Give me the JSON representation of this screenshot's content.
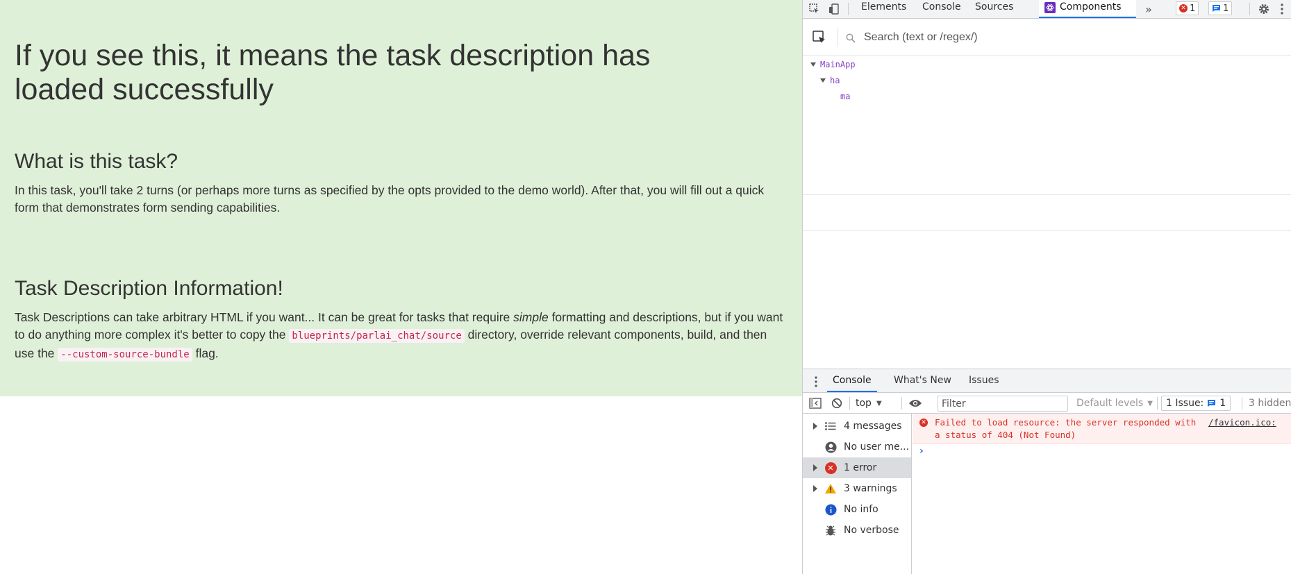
{
  "page": {
    "title": "If you see this, it means the task description has loaded successfully",
    "sections": [
      {
        "heading": "What is this task?",
        "text": "In this task, you'll take 2 turns (or perhaps more turns as specified by the opts provided to the demo world). After that, you will fill out a quick form that demonstrates form sending capabilities."
      },
      {
        "heading": "Task Description Information!",
        "text_part1": "Task Descriptions can take arbitrary HTML if you want... It can be great for tasks that require ",
        "text_em": "simple",
        "text_part2": " formatting and descriptions, but if you want to do anything more complex it's better to copy the ",
        "code1": "blueprints/parlai_chat/source",
        "text_part3": " directory, override relevant components, build, and then use the ",
        "code2": "--custom-source-bundle",
        "text_part4": " flag."
      }
    ],
    "colors": {
      "panel_bg": "#dff0d8",
      "code_fg": "#c7254e",
      "code_bg": "#f9f2f4"
    }
  },
  "devtools": {
    "tabs": [
      "Elements",
      "Console",
      "Sources",
      "Components"
    ],
    "active_tab": "Components",
    "more_tabs_icon": "chevron-double-right-icon",
    "error_count": "1",
    "issue_count": "1",
    "components": {
      "search_placeholder": "Search (text or /regex/)",
      "tree": [
        "MainApp",
        "ha",
        "ma"
      ]
    },
    "drawer": {
      "tabs": [
        "Console",
        "What's New",
        "Issues"
      ],
      "active_tab": "Console",
      "context": "top",
      "filter_placeholder": "Filter",
      "levels": "Default levels",
      "issues_label": "1 Issue:",
      "issues_count": "1",
      "hidden": "3 hidden",
      "sidebar": [
        {
          "label": "4 messages",
          "icon": "list-icon",
          "expandable": true
        },
        {
          "label": "No user me...",
          "icon": "user-icon",
          "expandable": false
        },
        {
          "label": "1 error",
          "icon": "error-icon",
          "expandable": true,
          "selected": true
        },
        {
          "label": "3 warnings",
          "icon": "warning-icon",
          "expandable": true
        },
        {
          "label": "No info",
          "icon": "info-icon",
          "expandable": false
        },
        {
          "label": "No verbose",
          "icon": "bug-icon",
          "expandable": false
        }
      ],
      "error_message": "Failed to load resource: the server responded with a status of 404 (Not Found)",
      "error_source": "/favicon.ico:",
      "prompt": "›"
    }
  }
}
